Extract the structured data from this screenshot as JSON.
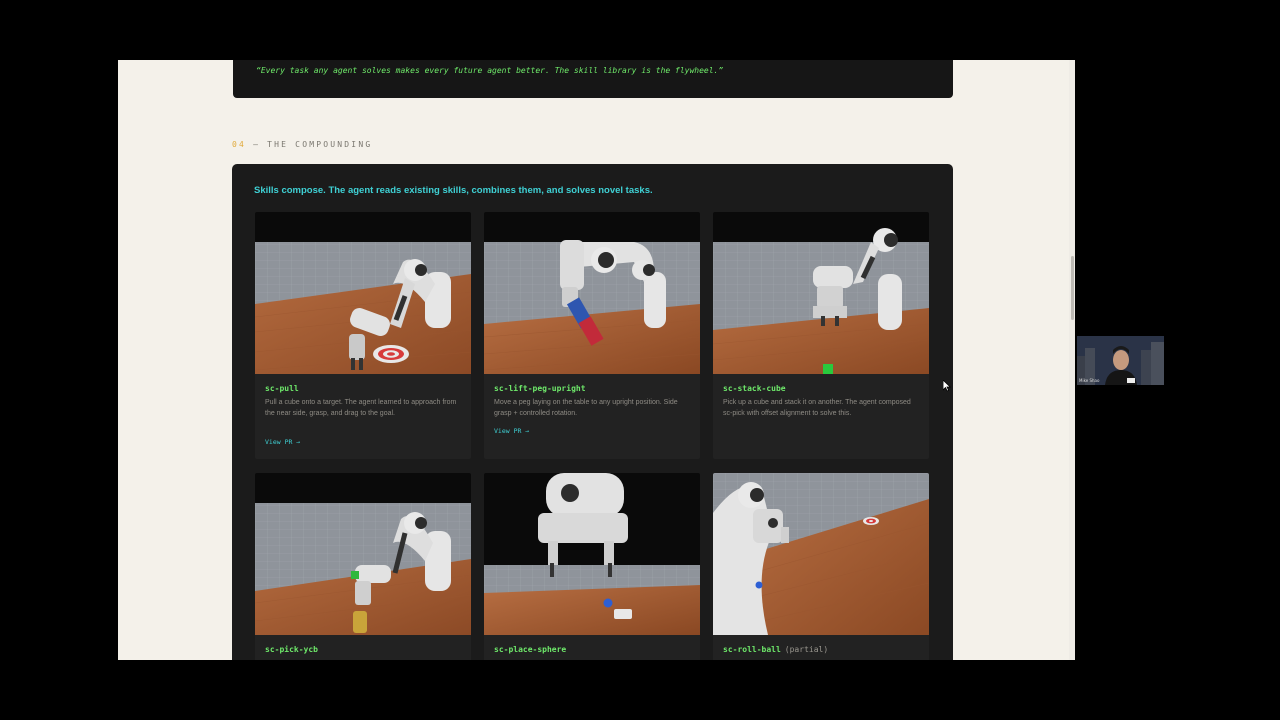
{
  "quote": "“Every task any agent solves makes every future agent better. The skill library is the flywheel.”",
  "section": {
    "number": "04",
    "separator": " — ",
    "title": "THE COMPOUNDING"
  },
  "panel_heading": "Skills compose. The agent reads existing skills, combines them, and solves novel tasks.",
  "cards": [
    {
      "title": "sc-pull",
      "tag": "",
      "description": "Pull a cube onto a target. The agent learned to approach from the near side, grasp, and drag to the goal.",
      "link": "View PR →"
    },
    {
      "title": "sc-lift-peg-upright",
      "tag": "",
      "description": "Move a peg laying on the table to any upright position. Side grasp + controlled rotation.",
      "link": "View PR →"
    },
    {
      "title": "sc-stack-cube",
      "tag": "",
      "description": "Pick up a cube and stack it on another. The agent composed sc-pick with offset alignment to solve this.",
      "link": ""
    },
    {
      "title": "sc-pick-ycb",
      "tag": "",
      "description": "",
      "link": ""
    },
    {
      "title": "sc-place-sphere",
      "tag": "",
      "description": "",
      "link": ""
    },
    {
      "title": "sc-roll-ball",
      "tag": "(partial)",
      "description": "",
      "link": ""
    }
  ],
  "webcam": {
    "name": "Mike Shao"
  },
  "colors": {
    "accent_cyan": "#3fd0d4",
    "accent_green": "#6ee86a",
    "accent_orange": "#e0a93a",
    "panel_bg": "#1b1b1b",
    "page_bg": "#f4f1ea"
  }
}
